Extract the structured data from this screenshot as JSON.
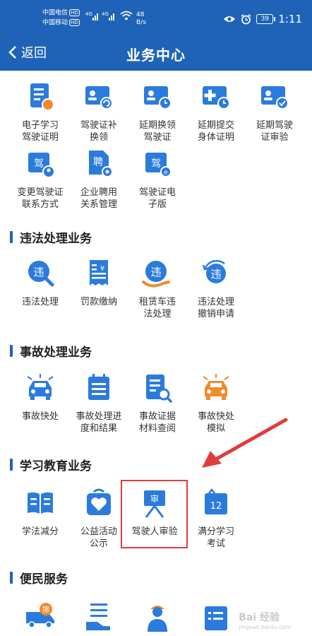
{
  "status_bar": {
    "carrier_1": "中国电信",
    "carrier_2": "中国移动",
    "hd": "HD",
    "signal_1": "4G",
    "signal_2": "4G",
    "speed_value": "48",
    "speed_unit": "B/s",
    "battery": "39",
    "time": "1:11"
  },
  "nav": {
    "back_label": "返回",
    "title": "业务中心"
  },
  "sections": {
    "driver_license_top": [
      {
        "label": "电子学习\n驾驶证明"
      },
      {
        "label": "驾驶证补\n换领"
      },
      {
        "label": "延期换领\n驾驶证"
      },
      {
        "label": "延期提交\n身体证明"
      },
      {
        "label": "延期驾驶\n证审验"
      },
      {
        "label": "变更驾驶证\n联系方式",
        "icon_text": "驾"
      },
      {
        "label": "企业聘用\n关系管理",
        "icon_text": "聘"
      },
      {
        "label": "驾驶证电\n子版",
        "icon_text": "驾"
      }
    ],
    "violation": {
      "title": "违法处理业务",
      "items": [
        {
          "label": "违法处理",
          "icon_text": "违"
        },
        {
          "label": "罚款缴纳",
          "icon_text": "¥"
        },
        {
          "label": "租赁车违\n法处理",
          "icon_text": "违"
        },
        {
          "label": "违法处理\n撤销申请",
          "icon_text": "违"
        }
      ]
    },
    "accident": {
      "title": "事故处理业务",
      "items": [
        {
          "label": "事故快处"
        },
        {
          "label": "事故处理进\n度和结果"
        },
        {
          "label": "事故证据\n材料查阅"
        },
        {
          "label": "事故快处\n模拟"
        }
      ]
    },
    "education": {
      "title": "学习教育业务",
      "items": [
        {
          "label": "学法减分"
        },
        {
          "label": "公益活动\n公示"
        },
        {
          "label": "驾驶人审验",
          "icon_text": "审"
        },
        {
          "label": "满分学习\n考试",
          "icon_text": "12"
        }
      ]
    },
    "convenience": {
      "title": "便民服务",
      "items": [
        {
          "label": "",
          "icon_text": "挪"
        },
        {
          "label": ""
        },
        {
          "label": ""
        },
        {
          "label": ""
        }
      ]
    }
  },
  "watermark": {
    "text": "Bai 经验",
    "sub": "jingyan.baidu.com"
  },
  "colors": {
    "header": "#1f63b8",
    "icon_blue": "#2b7bdc",
    "icon_orange": "#f08a2c",
    "highlight": "#e23b3b"
  }
}
